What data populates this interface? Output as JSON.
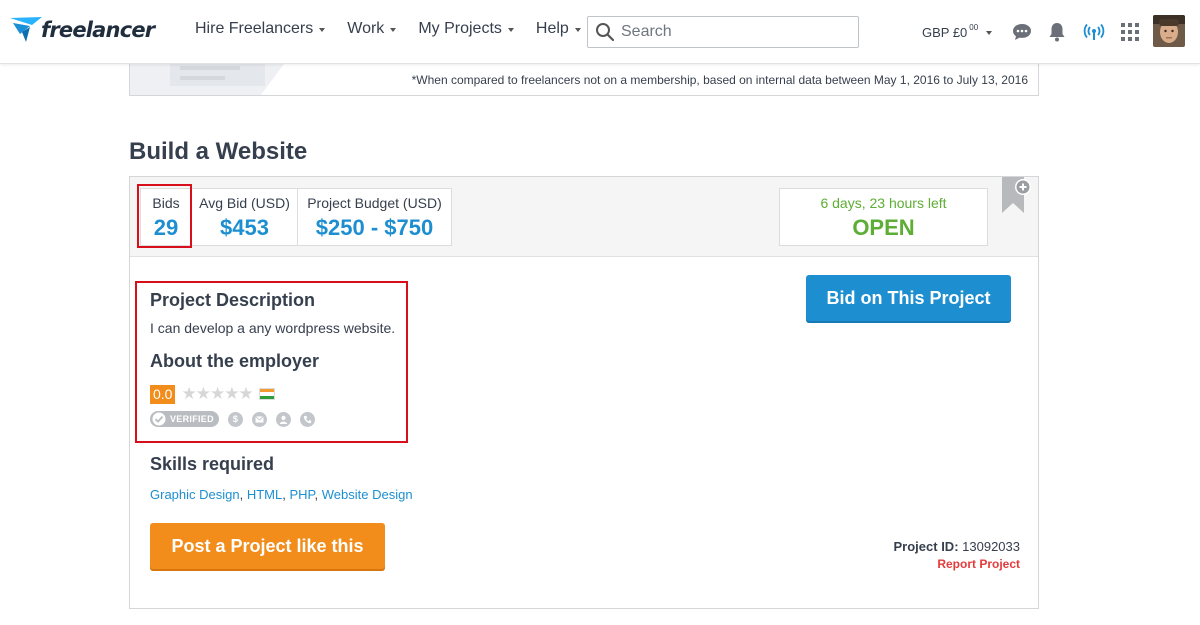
{
  "nav": {
    "logo_text": "freelancer",
    "links": [
      {
        "label": "Hire Freelancers"
      },
      {
        "label": "Work"
      },
      {
        "label": "My Projects"
      },
      {
        "label": "Help"
      }
    ],
    "search_placeholder": "Search",
    "balance": "GBP £0",
    "balance_cents": "00"
  },
  "banner": {
    "note": "*When compared to freelancers not on a membership, based on internal data between May 1, 2016 to July 13, 2016"
  },
  "project": {
    "title": "Build a Website",
    "stats": [
      {
        "label": "Bids",
        "value": "29"
      },
      {
        "label": "Avg Bid (USD)",
        "value": "$453"
      },
      {
        "label": "Project Budget (USD)",
        "value": "$250 - $750"
      }
    ],
    "time_left": "6 days, 23 hours left",
    "status": "OPEN",
    "bid_button": "Bid on This Project",
    "description_title": "Project Description",
    "description": "I can develop a any wordpress website.",
    "employer_title": "About the employer",
    "rating": "0.0",
    "stars": "★★★★★",
    "verified_label": "VERIFIED",
    "skills_title": "Skills required",
    "skills": [
      "Graphic Design",
      "HTML",
      "PHP",
      "Website Design"
    ],
    "post_button": "Post a Project like this",
    "project_id_label": "Project ID:",
    "project_id": "13092033",
    "report_label": "Report Project"
  },
  "colors": {
    "accent_blue": "#1d8fd1",
    "open_green": "#5dae34",
    "orange": "#f28c1a",
    "highlight_red": "#d80f1b",
    "report_red": "#e43b3b"
  }
}
